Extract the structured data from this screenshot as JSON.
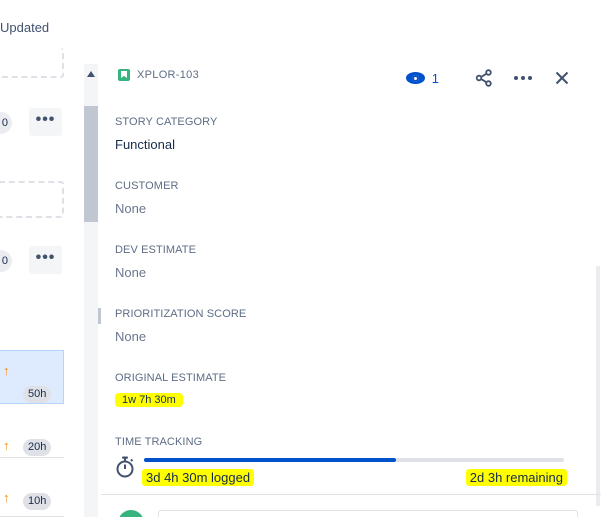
{
  "backlog": {
    "column_header": "Updated",
    "rows": [
      {
        "pill": "0"
      },
      {
        "pill": "0"
      }
    ],
    "more_label": "•••",
    "issues": [
      {
        "estimate": "50h",
        "priority_icon": "arrow-up-icon",
        "selected": true
      },
      {
        "estimate": "20h",
        "priority_icon": "arrow-up-icon",
        "selected": false
      },
      {
        "estimate": "10h",
        "priority_icon": "arrow-up-icon",
        "selected": false
      }
    ]
  },
  "issue_panel": {
    "issue_key": "XPLOR-103",
    "issue_type_icon": "story-icon",
    "watchers_count": "1",
    "actions": [
      "share-icon",
      "more-icon",
      "close-icon"
    ],
    "fields": [
      {
        "label": "STORY CATEGORY",
        "value": "Functional",
        "empty": false
      },
      {
        "label": "CUSTOMER",
        "value": "None",
        "empty": true
      },
      {
        "label": "DEV ESTIMATE",
        "value": "None",
        "empty": true
      },
      {
        "label": "PRIORITIZATION SCORE",
        "value": "None",
        "empty": true
      }
    ],
    "original_estimate": {
      "label": "ORIGINAL ESTIMATE",
      "value": "1w 7h 30m"
    },
    "time_tracking": {
      "label": "TIME TRACKING",
      "logged": "3d 4h 30m logged",
      "remaining": "2d 3h remaining",
      "progress_fraction": 0.6
    },
    "highlight_color": "#ffff00",
    "accent_color": "#0052cc"
  }
}
